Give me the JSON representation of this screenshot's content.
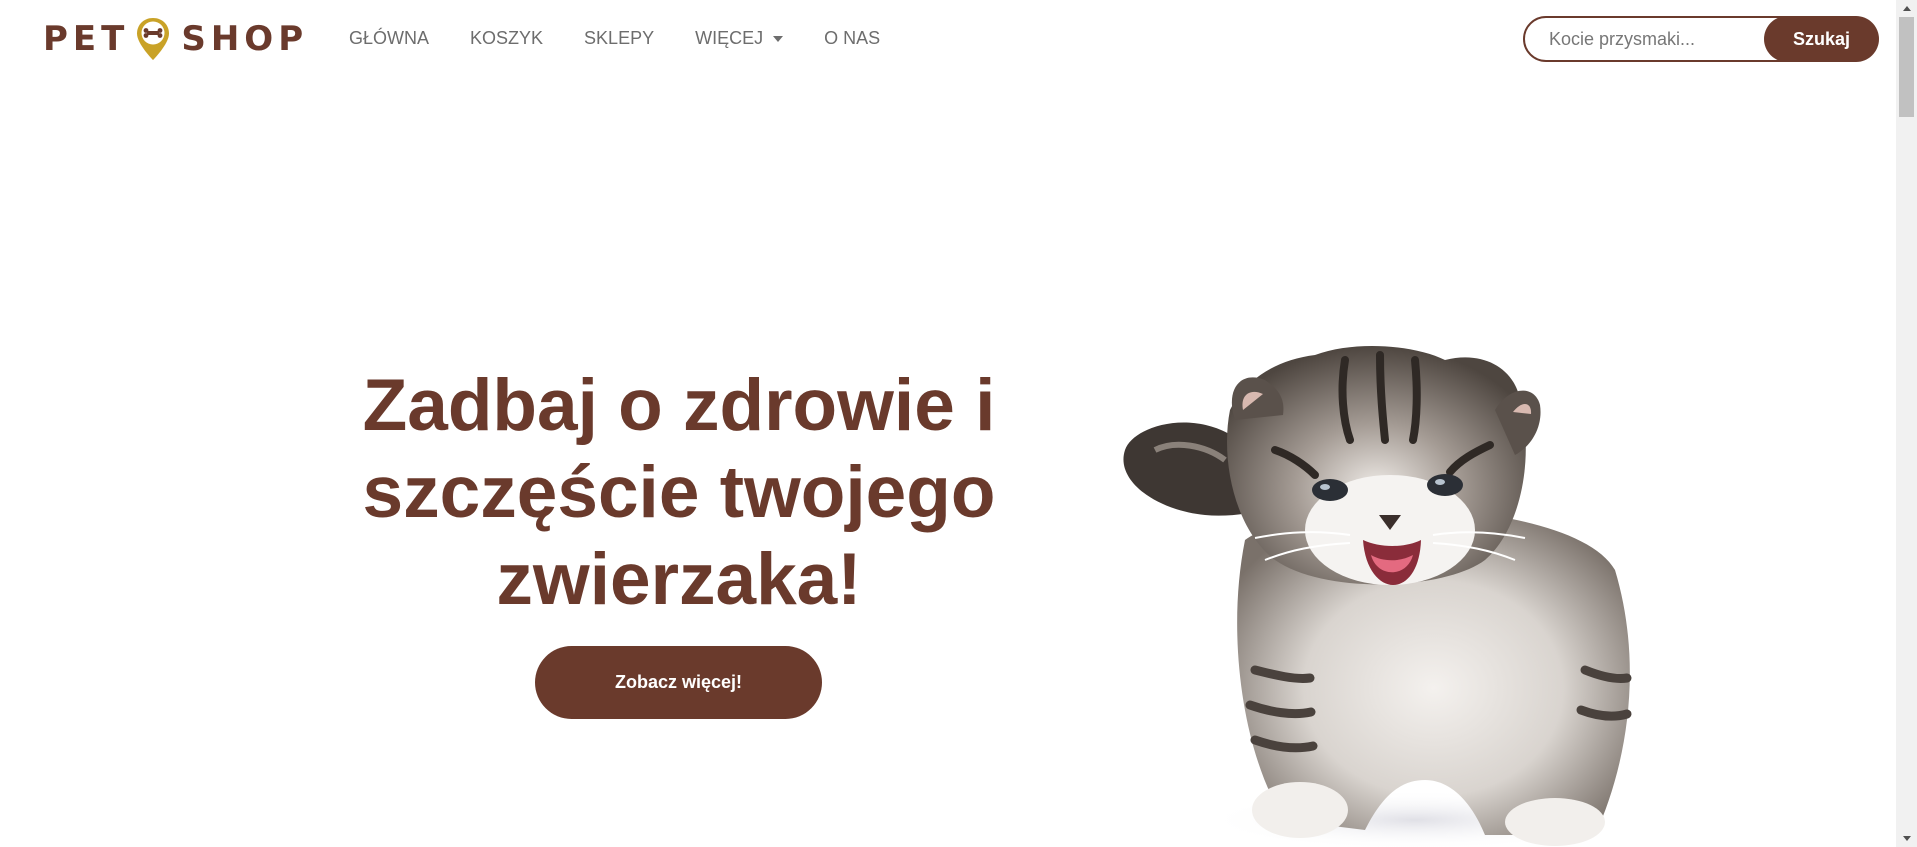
{
  "colors": {
    "brand": "#6a3a2c",
    "logo_pin": "#c9a227",
    "nav_text": "#6d6d6d",
    "background": "#ffffff"
  },
  "logo": {
    "left_text": "PET",
    "right_text": "SHOP",
    "icon": "location-pin-bone-icon"
  },
  "nav": {
    "items": [
      {
        "label": "GŁÓWNA"
      },
      {
        "label": "KOSZYK"
      },
      {
        "label": "SKLEPY"
      },
      {
        "label": "WIĘCEJ",
        "dropdown": true
      },
      {
        "label": "O NAS"
      }
    ]
  },
  "search": {
    "placeholder": "Kocie przysmaki...",
    "value": "",
    "button_label": "Szukaj"
  },
  "hero": {
    "title": "Zadbaj o zdrowie i szczęście twojego zwierzaka!",
    "cta_label": "Zobacz więcej!",
    "image": "kitten-photo"
  }
}
